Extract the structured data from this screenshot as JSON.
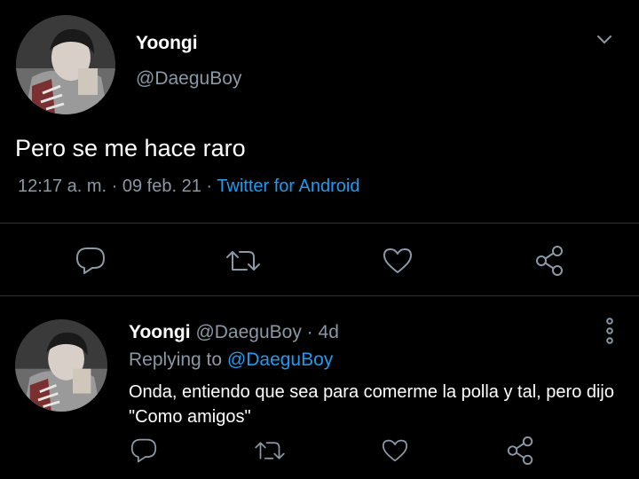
{
  "main_tweet": {
    "display_name": "Yoongi",
    "handle": "@DaeguBoy",
    "text": "Pero se me hace raro",
    "time": "12:17 a. m.",
    "dot1": "·",
    "date": "09 feb. 21",
    "dot2": "·",
    "source": "Twitter for Android"
  },
  "reply_tweet": {
    "display_name": "Yoongi",
    "handle": "@DaeguBoy",
    "dot": "·",
    "age": "4d",
    "replying_label": "Replying to",
    "replying_handle": "@DaeguBoy",
    "text": "Onda, entiendo que sea para comerme la polla y tal, pero dijo \"Como amigos\""
  },
  "icons": {
    "reply": "reply-icon",
    "retweet": "retweet-icon",
    "like": "heart-icon",
    "share": "share-icon",
    "menu_chevron": "chevron-down-icon",
    "menu_dots": "more-vertical-icon"
  },
  "colors": {
    "background": "#000000",
    "text": "#ffffff",
    "muted": "#8b98a5",
    "link": "#1d9bf0",
    "divider": "#2f3336"
  }
}
